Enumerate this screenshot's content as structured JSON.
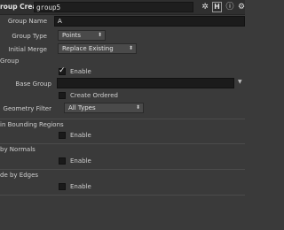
{
  "header": {
    "title": "roup Create",
    "node_name": "group5"
  },
  "params": {
    "group_name_label": "Group Name",
    "group_name_value": "A",
    "group_type_label": "Group Type",
    "group_type_value": "Points",
    "initial_merge_label": "Initial Merge",
    "initial_merge_value": "Replace Existing"
  },
  "base_group_section": {
    "title": "Group",
    "enable_label": "Enable",
    "enable_checked": true,
    "base_group_label": "Base Group",
    "base_group_value": "",
    "create_ordered_label": "Create Ordered",
    "geometry_filter_label": "Geometry Filter",
    "geometry_filter_value": "All Types"
  },
  "bounding_section": {
    "title": "in Bounding Regions",
    "enable_label": "Enable"
  },
  "normals_section": {
    "title": "by Normals",
    "enable_label": "Enable"
  },
  "edges_section": {
    "title": "de by Edges",
    "enable_label": "Enable"
  }
}
